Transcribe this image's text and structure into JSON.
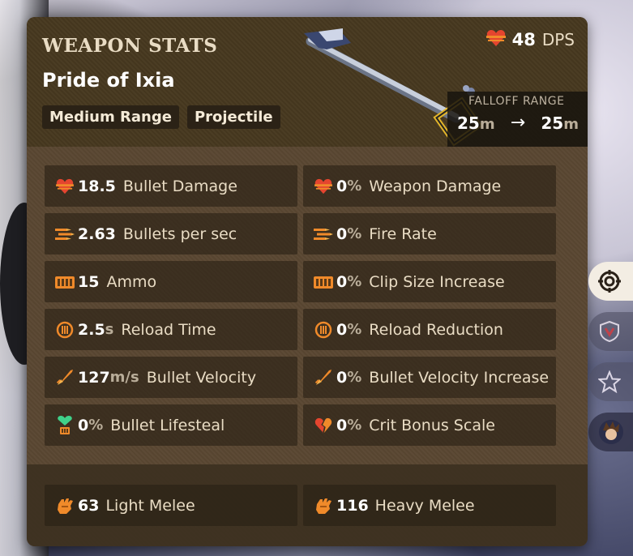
{
  "header": {
    "title": "WEAPON STATS",
    "weapon_name": "Pride of Ixia",
    "tags": [
      "Medium Range",
      "Projectile"
    ],
    "dps_value": "48",
    "dps_unit": "DPS",
    "falloff_label": "FALLOFF RANGE",
    "falloff_min": "25",
    "falloff_max": "25",
    "falloff_unit": "m"
  },
  "stats": {
    "left": [
      {
        "icon": "damage-heart-icon",
        "value": "18.5",
        "unit": "",
        "label": "Bullet Damage"
      },
      {
        "icon": "bullets-icon",
        "value": "2.63",
        "unit": "",
        "label": "Bullets per sec"
      },
      {
        "icon": "ammo-icon",
        "value": "15",
        "unit": "",
        "label": "Ammo"
      },
      {
        "icon": "reload-icon",
        "value": "2.5",
        "unit": "s",
        "label": "Reload Time"
      },
      {
        "icon": "velocity-icon",
        "value": "127",
        "unit": "m/s",
        "label": "Bullet Velocity"
      },
      {
        "icon": "lifesteal-icon",
        "value": "0",
        "unit": "%",
        "label": "Bullet Lifesteal"
      }
    ],
    "right": [
      {
        "icon": "damage-heart-icon",
        "value": "0",
        "unit": "%",
        "label": "Weapon Damage"
      },
      {
        "icon": "bullets-icon",
        "value": "0",
        "unit": "%",
        "label": "Fire Rate"
      },
      {
        "icon": "ammo-icon",
        "value": "0",
        "unit": "%",
        "label": "Clip Size Increase"
      },
      {
        "icon": "reload-icon",
        "value": "0",
        "unit": "%",
        "label": "Reload Reduction"
      },
      {
        "icon": "velocity-icon",
        "value": "0",
        "unit": "%",
        "label": "Bullet Velocity Increase"
      },
      {
        "icon": "crit-broken-heart-icon",
        "value": "0",
        "unit": "%",
        "label": "Crit Bonus Scale"
      }
    ]
  },
  "melee": [
    {
      "icon": "fist-icon",
      "value": "63",
      "label": "Light Melee"
    },
    {
      "icon": "fist-icon",
      "value": "116",
      "label": "Heavy Melee"
    }
  ],
  "side_tabs": [
    "target-icon",
    "shield-badge-icon",
    "star-icon",
    "hero-portrait-icon"
  ],
  "colors": {
    "accent_orange": "#f08a2a",
    "accent_red": "#e5452f",
    "lifesteal_green": "#3fd18a",
    "card_bg": "#5a4732",
    "header_bg": "#47381f"
  }
}
